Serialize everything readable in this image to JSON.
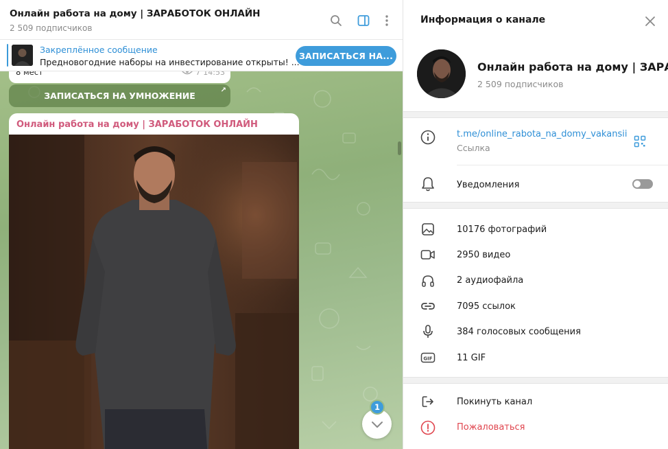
{
  "chat": {
    "title": "Онлайн работа на дому | ЗАРАБОТОК ОНЛАЙН",
    "subscribers": "2 509 подписчиков",
    "icons": [
      "search-icon",
      "sidebar-toggle-icon",
      "more-vert-icon"
    ]
  },
  "pinned": {
    "label": "Закреплённое сообщение",
    "text": "Предновогодние наборы на инвестирование открыты!  ...",
    "button": "ЗАПИСАТЬСЯ НА..."
  },
  "feed": {
    "prev_text": "8 мест",
    "prev_views": "7",
    "prev_time": "14:53",
    "inline_button": "ЗАПИСАТЬСЯ НА УМНОЖЕНИЕ",
    "post_author": "Онлайн работа на дому | ЗАРАБОТОК ОНЛАЙН",
    "unread_count": "1"
  },
  "info": {
    "title": "Информация о канале",
    "channel_name": "Онлайн работа на дому | ЗАРАБОТОК ОНЛАЙН",
    "subscribers": "2 509 подписчиков",
    "link": "t.me/online_rabota_na_domy_vakansii",
    "link_label": "Ссылка",
    "notifications_label": "Уведомления",
    "notifications_on": false,
    "media": [
      {
        "icon": "photo-icon",
        "label": "10176 фотографий"
      },
      {
        "icon": "video-icon",
        "label": "2950 видео"
      },
      {
        "icon": "headphones-icon",
        "label": "2 аудиофайла"
      },
      {
        "icon": "link-icon",
        "label": "7095 ссылок"
      },
      {
        "icon": "microphone-icon",
        "label": "384 голосовых сообщения"
      },
      {
        "icon": "gif-icon",
        "label": "11 GIF"
      }
    ],
    "leave_label": "Покинуть канал",
    "report_label": "Пожаловаться"
  },
  "colors": {
    "accent": "#3e9cdb",
    "author": "#d05a7c",
    "danger": "#e0454e"
  }
}
